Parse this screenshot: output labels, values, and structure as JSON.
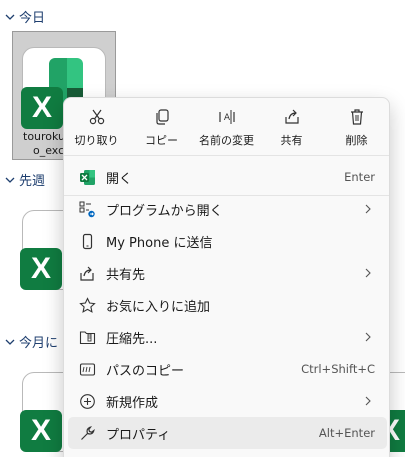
{
  "groups": {
    "today": "今日",
    "last_week": "先週",
    "this_month": "今月に"
  },
  "selected_file": {
    "name_line1": "touroku",
    "name_line2": "o_exc"
  },
  "quick_actions": [
    {
      "label": "切り取り",
      "icon": "scissors-icon"
    },
    {
      "label": "コピー",
      "icon": "copy-icon"
    },
    {
      "label": "名前の変更",
      "icon": "rename-icon"
    },
    {
      "label": "共有",
      "icon": "share-icon"
    },
    {
      "label": "削除",
      "icon": "trash-icon"
    }
  ],
  "menu_items": [
    {
      "label": "開く",
      "shortcut": "Enter",
      "icon": "excel-icon",
      "submenu": false
    },
    {
      "label": "プログラムから開く",
      "shortcut": "",
      "icon": "open-with-icon",
      "submenu": true
    },
    {
      "label": "My Phone に送信",
      "shortcut": "",
      "icon": "phone-icon",
      "submenu": false
    },
    {
      "label": "共有先",
      "shortcut": "",
      "icon": "share-to-icon",
      "submenu": true
    },
    {
      "label": "お気に入りに追加",
      "shortcut": "",
      "icon": "star-icon",
      "submenu": false
    },
    {
      "label": "圧縮先...",
      "shortcut": "",
      "icon": "zip-folder-icon",
      "submenu": true
    },
    {
      "label": "パスのコピー",
      "shortcut": "Ctrl+Shift+C",
      "icon": "copy-path-icon",
      "submenu": false
    },
    {
      "label": "新規作成",
      "shortcut": "",
      "icon": "new-icon",
      "submenu": true
    },
    {
      "label": "プロパティ",
      "shortcut": "Alt+Enter",
      "icon": "wrench-icon",
      "submenu": false
    }
  ],
  "colors": {
    "excel_green": "#107c41",
    "accent_blue": "#1f3f6f",
    "menu_bg": "#f9f9f9",
    "hover_bg": "#ebebeb"
  }
}
